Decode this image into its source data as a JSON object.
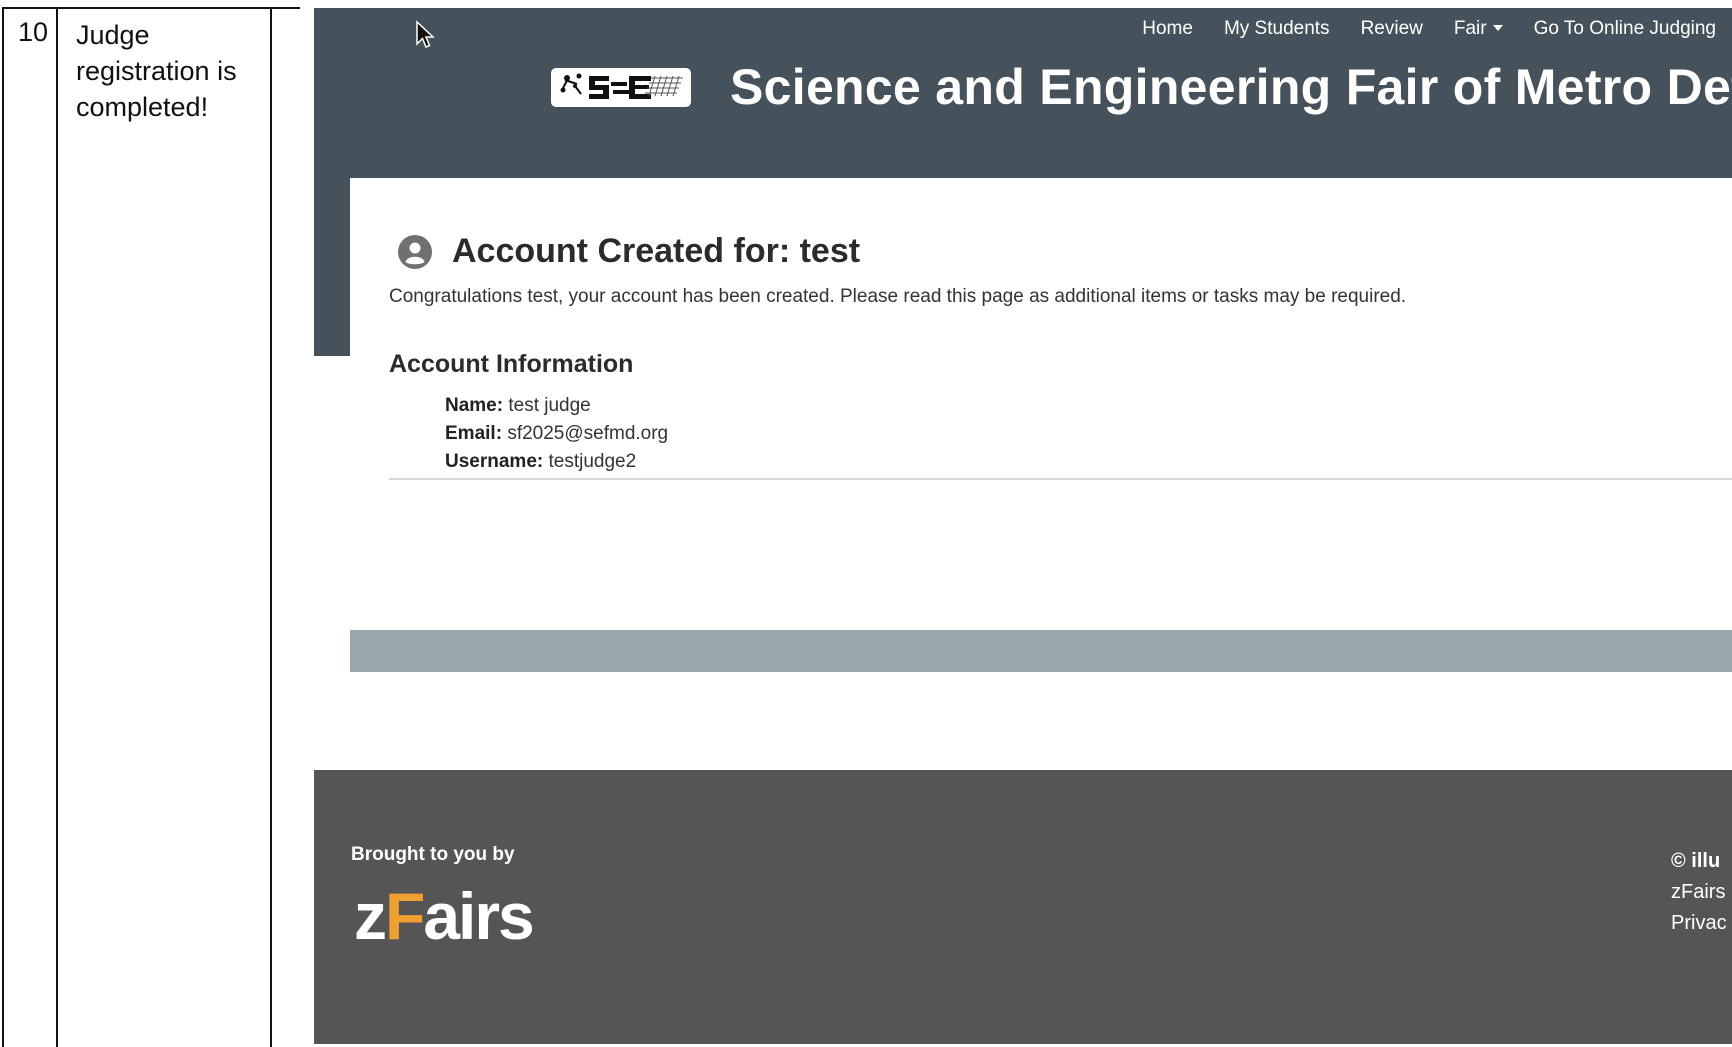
{
  "doc": {
    "row_number": "10",
    "row_description": "Judge registration is completed!"
  },
  "nav": {
    "items": [
      "Home",
      "My Students",
      "Review",
      "Fair",
      "Go To Online Judging"
    ]
  },
  "site": {
    "title": "Science and Engineering Fair of Metro Detro"
  },
  "page": {
    "title": "Account Created for: test",
    "congrats": "Congratulations test, your account has been created. Please read this page as additional items or tasks may be required.",
    "section_title": "Account Information",
    "info": {
      "name_label": "Name:",
      "name_value": "test judge",
      "email_label": "Email:",
      "email_value": "sf2025@sefmd.org",
      "username_label": "Username:",
      "username_value": "testjudge2"
    }
  },
  "footer": {
    "brought_by": "Brought to you by",
    "brand_z": "z",
    "brand_f": "F",
    "brand_rest": "airs",
    "copyright": "© illu",
    "link1": "zFairs",
    "link2": "Privac"
  },
  "colors": {
    "header_bg": "#46525b",
    "card_footer": "#9aa6ae",
    "footer_bg": "#555555",
    "brand_accent": "#f0a030"
  }
}
